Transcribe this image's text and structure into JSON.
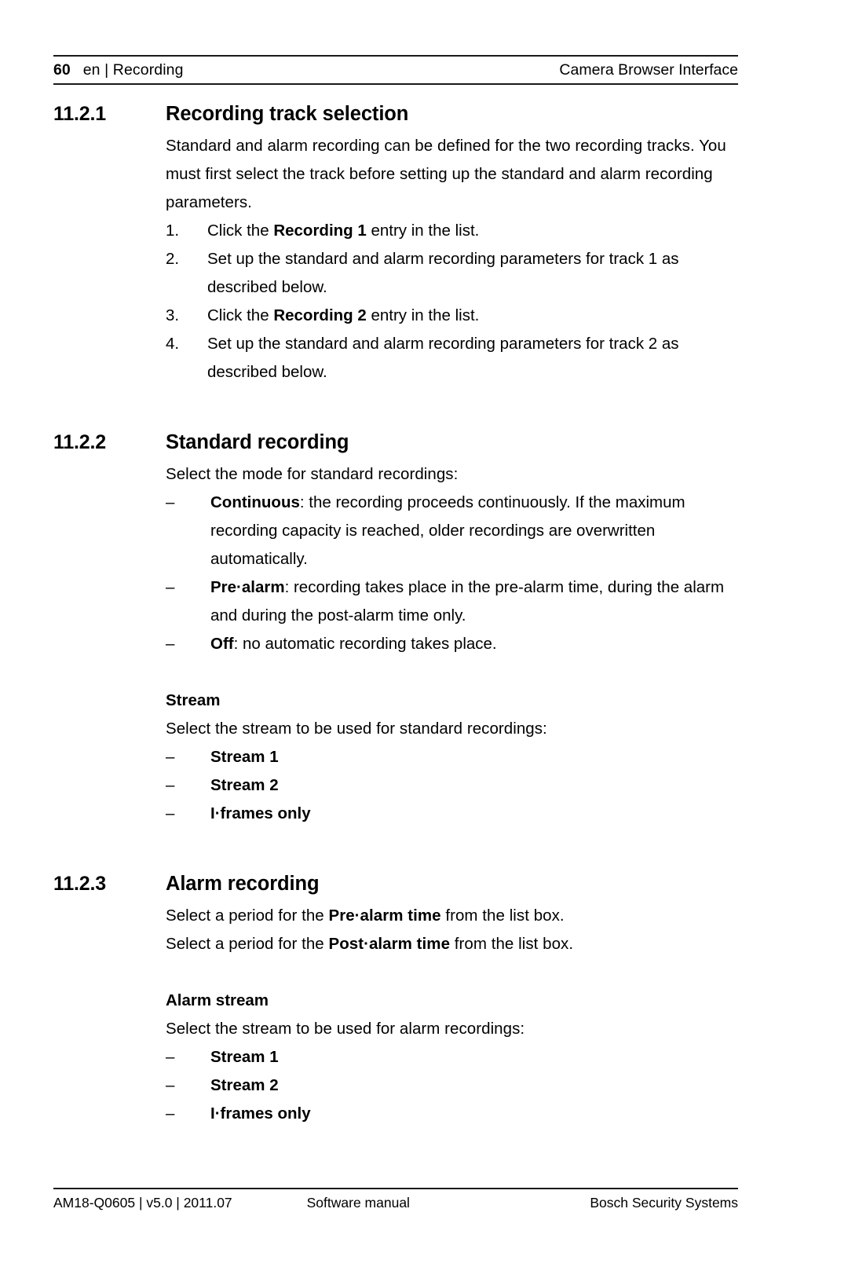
{
  "header": {
    "page_number": "60",
    "language_and_chapter": "en | Recording",
    "document_title": "Camera Browser Interface"
  },
  "sections": [
    {
      "number": "11.2.1",
      "title": "Recording track selection",
      "intro": "Standard and alarm recording can be defined for the two recording tracks. You must first select the track before setting up the standard and alarm recording parameters.",
      "steps": [
        {
          "marker": "1.",
          "pre": "Click the ",
          "bold": "Recording 1",
          "post": " entry in the list."
        },
        {
          "marker": "2.",
          "pre": "Set up the standard and alarm recording parameters for track 1 as described below.",
          "bold": "",
          "post": ""
        },
        {
          "marker": "3.",
          "pre": "Click the ",
          "bold": "Recording 2",
          "post": " entry in the list."
        },
        {
          "marker": "4.",
          "pre": "Set up the standard and alarm recording parameters for track 2 as described below.",
          "bold": "",
          "post": ""
        }
      ]
    },
    {
      "number": "11.2.2",
      "title": "Standard recording",
      "intro": "Select the mode for standard recordings:",
      "modes": [
        {
          "marker": "–",
          "bold": "Continuous",
          "rest": ": the recording proceeds continuously. If the maximum recording capacity is reached, older recordings are overwritten automatically."
        },
        {
          "marker": "–",
          "bold": "Pre·alarm",
          "rest": ": recording takes place in the pre-alarm time, during the alarm and during the post-alarm time only."
        },
        {
          "marker": "–",
          "bold": "Off",
          "rest": ": no automatic recording takes place."
        }
      ],
      "stream_heading": "Stream",
      "stream_intro": "Select the stream to be used for standard recordings:",
      "stream_options": [
        {
          "marker": "–",
          "bold": "Stream 1",
          "rest": ""
        },
        {
          "marker": "–",
          "bold": "Stream 2",
          "rest": ""
        },
        {
          "marker": "–",
          "bold": "I·frames only",
          "rest": ""
        }
      ]
    },
    {
      "number": "11.2.3",
      "title": "Alarm recording",
      "line1_pre": "Select a period for the ",
      "line1_bold": "Pre·alarm time",
      "line1_post": " from the list box.",
      "line2_pre": "Select a period for the ",
      "line2_bold": "Post·alarm time",
      "line2_post": " from the list box.",
      "stream_heading": "Alarm stream",
      "stream_intro": "Select the stream to be used for alarm recordings:",
      "stream_options": [
        {
          "marker": "–",
          "bold": "Stream 1",
          "rest": ""
        },
        {
          "marker": "–",
          "bold": "Stream 2",
          "rest": ""
        },
        {
          "marker": "–",
          "bold": "I·frames only",
          "rest": ""
        }
      ]
    }
  ],
  "footer": {
    "doc_id": "AM18-Q0605 | v5.0 | 2011.07",
    "doc_type": "Software manual",
    "company": "Bosch Security Systems"
  }
}
